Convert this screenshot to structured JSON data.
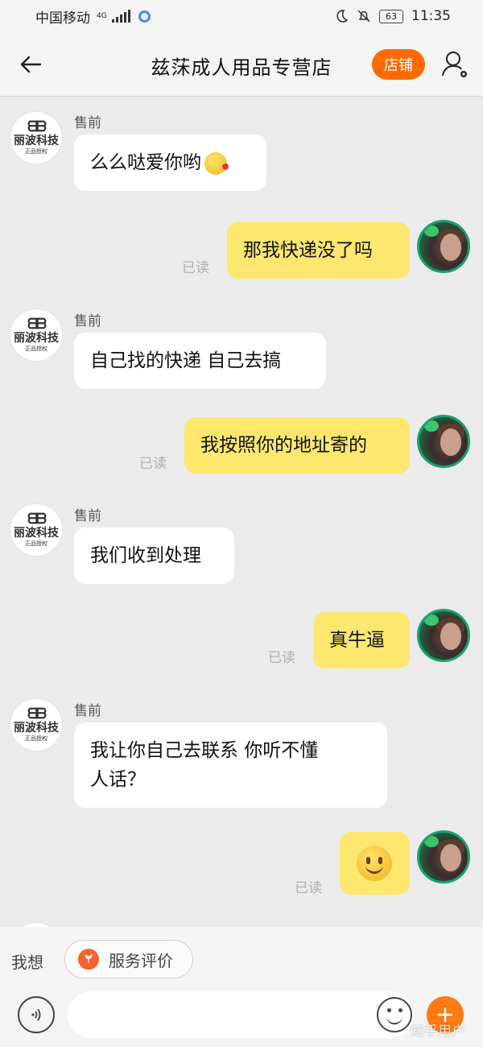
{
  "status_bar": {
    "carrier": "中国移动",
    "network": "4G",
    "battery": "63",
    "time": "11:35"
  },
  "header": {
    "title": "兹莯成人用品专营店",
    "shop_button": "店铺"
  },
  "store_avatar": {
    "logo_text": "丽波科技",
    "logo_sub": "正品授权"
  },
  "messages": [
    {
      "side": "in",
      "sender": "售前",
      "text": "么么哒爱你哟",
      "has_emoji": true
    },
    {
      "side": "out",
      "text": "那我快递没了吗",
      "status": "已读"
    },
    {
      "side": "in",
      "sender": "售前",
      "text": "自己找的快递 自己去搞"
    },
    {
      "side": "out",
      "text": "我按照你的地址寄的",
      "status": "已读"
    },
    {
      "side": "in",
      "sender": "售前",
      "text": "我们收到处理"
    },
    {
      "side": "out",
      "text": "真牛逼",
      "status": "已读"
    },
    {
      "side": "in",
      "sender": "售前",
      "text_line1": "我让你自己去联系 你听不懂",
      "text_line2": "人话？"
    },
    {
      "side": "out",
      "text": "",
      "sticker": "smile-emoji",
      "status": "已读"
    }
  ],
  "quick_bar": {
    "label": "我想",
    "chip": "服务评价"
  },
  "input_bar": {
    "placeholder": ""
  },
  "watermark": "知乎用户",
  "colors": {
    "accent": "#ff6a00",
    "out_bubble": "#fde76f",
    "in_bubble": "#ffffff",
    "background": "#ebebeb"
  }
}
